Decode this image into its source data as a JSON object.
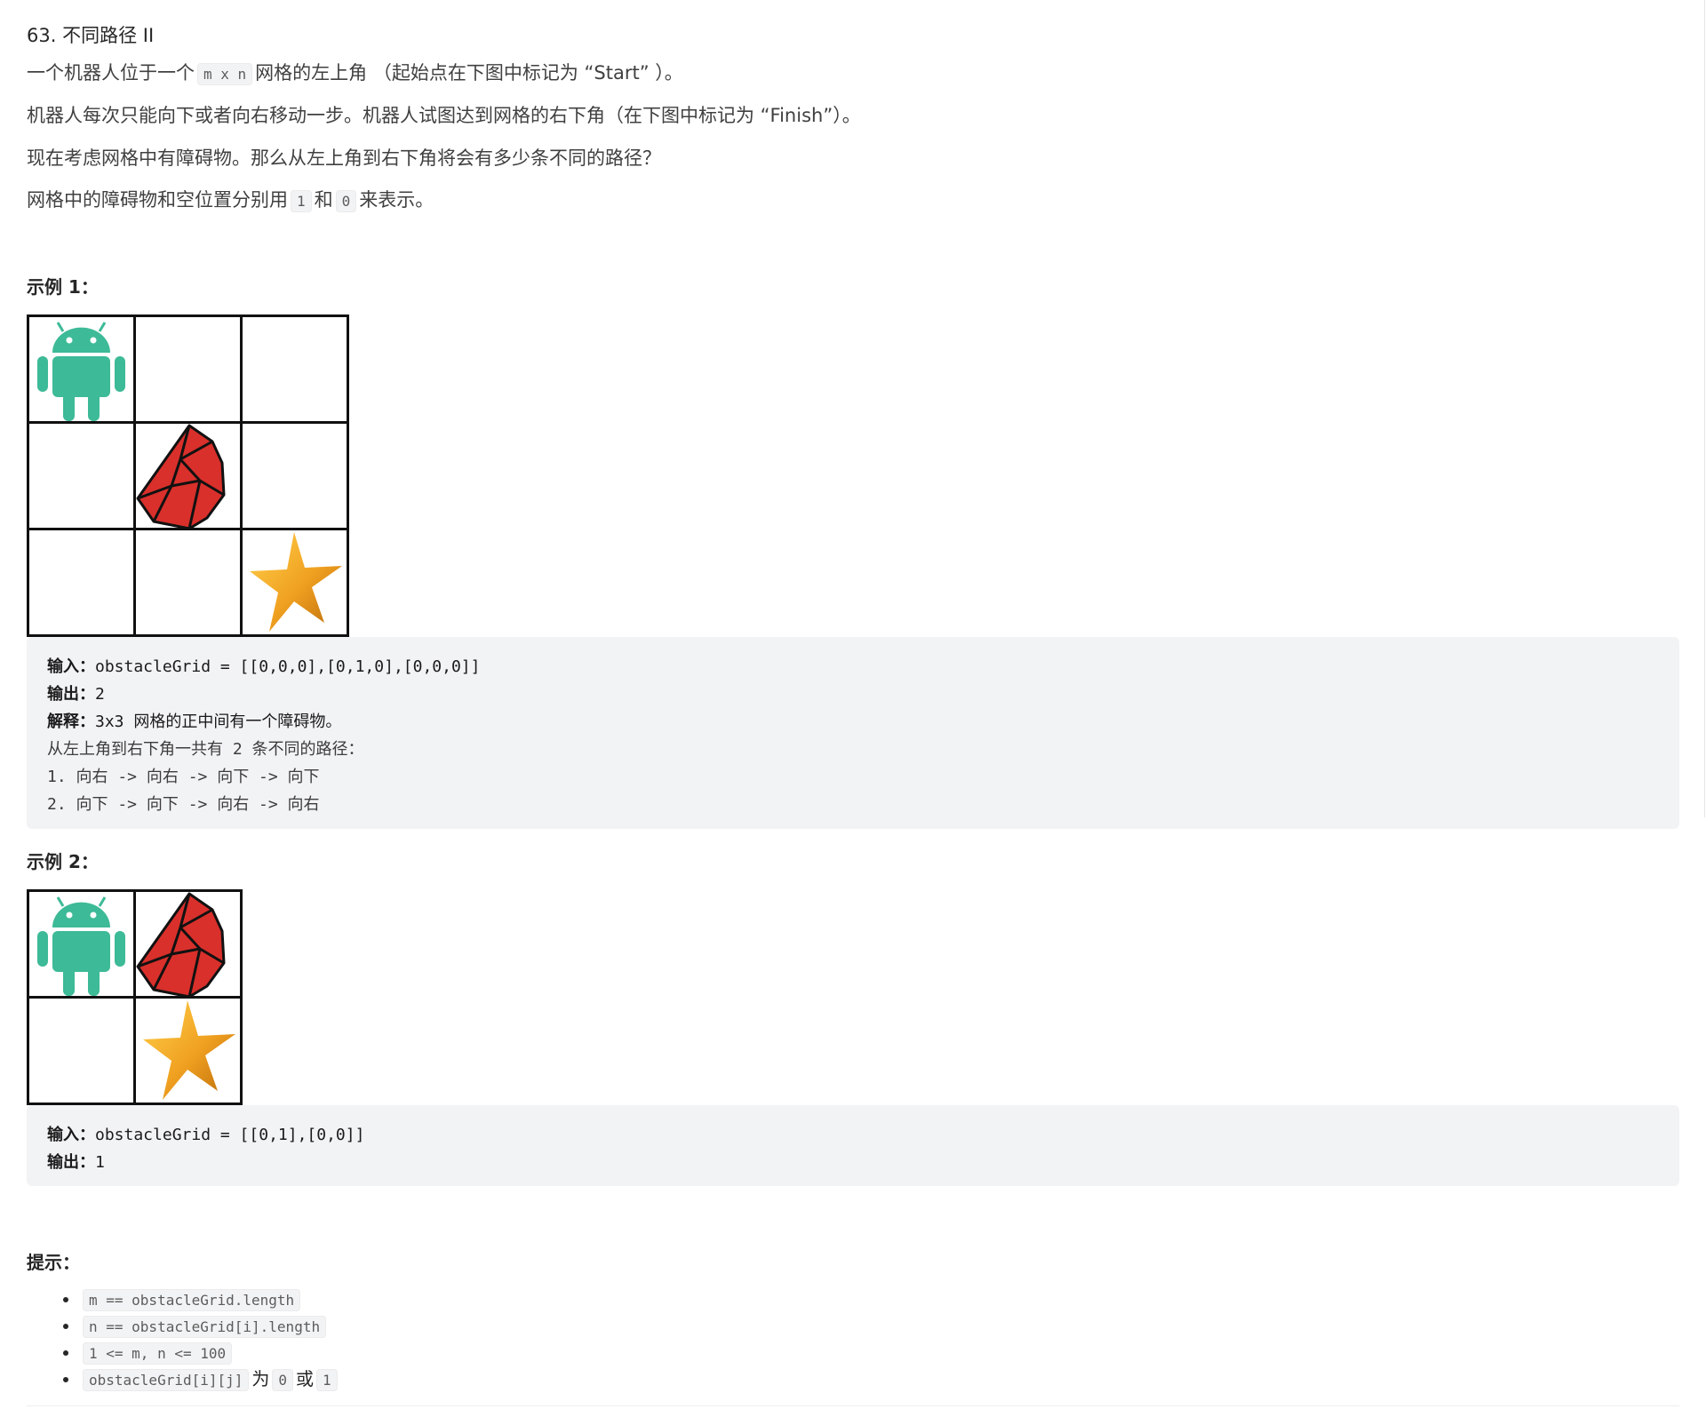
{
  "problem": {
    "title": "63. 不同路径 II",
    "p1_a": "一个机器人位于一个",
    "p1_code": "m x n",
    "p1_b": "网格的左上角 （起始点在下图中标记为 “Start” ）。",
    "p2": "机器人每次只能向下或者向右移动一步。机器人试图达到网格的右下角（在下图中标记为 “Finish”）。",
    "p3": "现在考虑网格中有障碍物。那么从左上角到右下角将会有多少条不同的路径？",
    "p4_a": "网格中的障碍物和空位置分别用",
    "p4_code1": "1",
    "p4_mid": "和",
    "p4_code2": "0",
    "p4_b": "来表示。"
  },
  "example1": {
    "heading": "示例 1：",
    "grid": [
      [
        "robot",
        "",
        ""
      ],
      [
        "",
        "obstacle",
        ""
      ],
      [
        "",
        "",
        "star"
      ]
    ],
    "input_label": "输入：",
    "input_value": "obstacleGrid = [[0,0,0],[0,1,0],[0,0,0]]",
    "output_label": "输出：",
    "output_value": "2",
    "explain_label": "解释：",
    "explain_value": "3x3 网格的正中间有一个障碍物。",
    "explain_line2": "从左上角到右下角一共有 2 条不同的路径：",
    "path1": "1. 向右 -> 向右 -> 向下 -> 向下",
    "path2": "2. 向下 -> 向下 -> 向右 -> 向右"
  },
  "example2": {
    "heading": "示例 2：",
    "grid": [
      [
        "robot",
        "obstacle"
      ],
      [
        "",
        "star"
      ]
    ],
    "input_label": "输入：",
    "input_value": "obstacleGrid = [[0,1],[0,0]]",
    "output_label": "输出：",
    "output_value": "1"
  },
  "hints": {
    "heading": "提示：",
    "h1": "m ==  obstacleGrid.length",
    "h2": "n ==  obstacleGrid[i].length",
    "h3": "1 <= m, n <= 100",
    "h4_code": "obstacleGrid[i][j]",
    "h4_a": "为",
    "h4_c1": "0",
    "h4_b": "或",
    "h4_c2": "1"
  },
  "colors": {
    "robot": "#3dba97",
    "obstacle": "#d9302b",
    "star": "#f0a020",
    "code_bg": "#f2f3f5"
  },
  "icons": {
    "start": "android-robot-icon",
    "obstacle": "red-gem-rock-icon",
    "finish": "gold-star-icon"
  }
}
